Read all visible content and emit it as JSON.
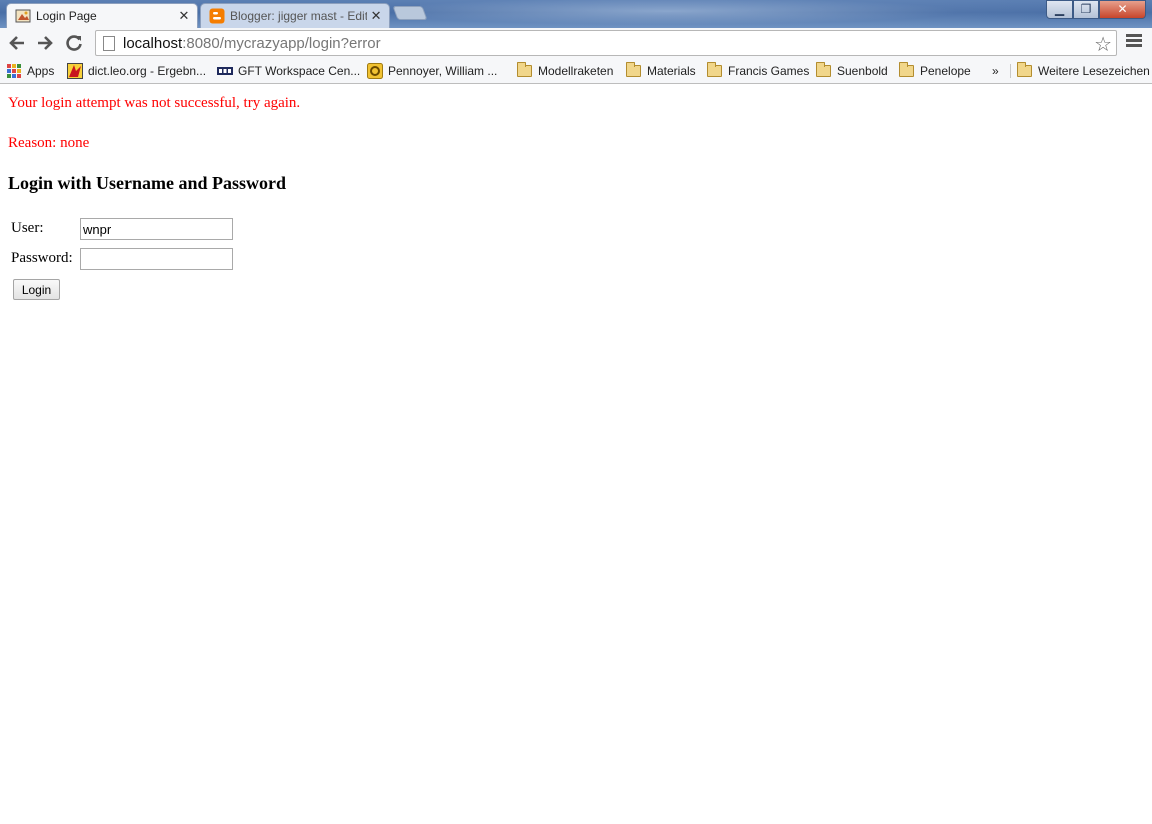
{
  "browser": {
    "tabs": [
      {
        "title": "Login Page",
        "active": true
      },
      {
        "title": "Blogger: jigger mast - Edit",
        "active": false
      }
    ],
    "url_host": "localhost",
    "url_rest": ":8080/mycrazyapp/login?error",
    "bookmarks": [
      {
        "label": "Apps",
        "icon": "apps-grid-icon"
      },
      {
        "label": "dict.leo.org - Ergebn...",
        "icon": "leo-favicon"
      },
      {
        "label": "GFT Workspace Cen...",
        "icon": "gft-favicon"
      },
      {
        "label": "Pennoyer, William ...",
        "icon": "outlook-favicon"
      },
      {
        "label": "Modellraketen",
        "icon": "folder-icon"
      },
      {
        "label": "Materials",
        "icon": "folder-icon"
      },
      {
        "label": "Francis Games",
        "icon": "folder-icon"
      },
      {
        "label": "Suenbold",
        "icon": "folder-icon"
      },
      {
        "label": "Penelope",
        "icon": "folder-icon"
      }
    ],
    "overflow_label": "»",
    "other_bookmarks": "Weitere Lesezeichen"
  },
  "page": {
    "error_message": "Your login attempt was not successful, try again.",
    "reason": "Reason: none",
    "heading": "Login with Username and Password",
    "form": {
      "user_label": "User:",
      "user_value": "wnpr",
      "password_label": "Password:",
      "password_value": "",
      "login_button": "Login"
    }
  },
  "colors": {
    "error": "#ff0000",
    "tab_active": "#f6f7f9",
    "tab_inactive": "#c9d6ea",
    "folder": "#f1d68a"
  }
}
